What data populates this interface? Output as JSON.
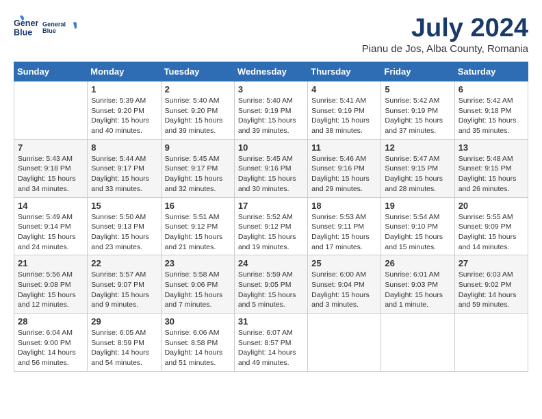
{
  "header": {
    "logo_line1": "General",
    "logo_line2": "Blue",
    "title": "July 2024",
    "subtitle": "Pianu de Jos, Alba County, Romania"
  },
  "calendar": {
    "days_of_week": [
      "Sunday",
      "Monday",
      "Tuesday",
      "Wednesday",
      "Thursday",
      "Friday",
      "Saturday"
    ],
    "weeks": [
      [
        {
          "day": "",
          "info": ""
        },
        {
          "day": "1",
          "info": "Sunrise: 5:39 AM\nSunset: 9:20 PM\nDaylight: 15 hours\nand 40 minutes."
        },
        {
          "day": "2",
          "info": "Sunrise: 5:40 AM\nSunset: 9:20 PM\nDaylight: 15 hours\nand 39 minutes."
        },
        {
          "day": "3",
          "info": "Sunrise: 5:40 AM\nSunset: 9:19 PM\nDaylight: 15 hours\nand 39 minutes."
        },
        {
          "day": "4",
          "info": "Sunrise: 5:41 AM\nSunset: 9:19 PM\nDaylight: 15 hours\nand 38 minutes."
        },
        {
          "day": "5",
          "info": "Sunrise: 5:42 AM\nSunset: 9:19 PM\nDaylight: 15 hours\nand 37 minutes."
        },
        {
          "day": "6",
          "info": "Sunrise: 5:42 AM\nSunset: 9:18 PM\nDaylight: 15 hours\nand 35 minutes."
        }
      ],
      [
        {
          "day": "7",
          "info": "Sunrise: 5:43 AM\nSunset: 9:18 PM\nDaylight: 15 hours\nand 34 minutes."
        },
        {
          "day": "8",
          "info": "Sunrise: 5:44 AM\nSunset: 9:17 PM\nDaylight: 15 hours\nand 33 minutes."
        },
        {
          "day": "9",
          "info": "Sunrise: 5:45 AM\nSunset: 9:17 PM\nDaylight: 15 hours\nand 32 minutes."
        },
        {
          "day": "10",
          "info": "Sunrise: 5:45 AM\nSunset: 9:16 PM\nDaylight: 15 hours\nand 30 minutes."
        },
        {
          "day": "11",
          "info": "Sunrise: 5:46 AM\nSunset: 9:16 PM\nDaylight: 15 hours\nand 29 minutes."
        },
        {
          "day": "12",
          "info": "Sunrise: 5:47 AM\nSunset: 9:15 PM\nDaylight: 15 hours\nand 28 minutes."
        },
        {
          "day": "13",
          "info": "Sunrise: 5:48 AM\nSunset: 9:15 PM\nDaylight: 15 hours\nand 26 minutes."
        }
      ],
      [
        {
          "day": "14",
          "info": "Sunrise: 5:49 AM\nSunset: 9:14 PM\nDaylight: 15 hours\nand 24 minutes."
        },
        {
          "day": "15",
          "info": "Sunrise: 5:50 AM\nSunset: 9:13 PM\nDaylight: 15 hours\nand 23 minutes."
        },
        {
          "day": "16",
          "info": "Sunrise: 5:51 AM\nSunset: 9:12 PM\nDaylight: 15 hours\nand 21 minutes."
        },
        {
          "day": "17",
          "info": "Sunrise: 5:52 AM\nSunset: 9:12 PM\nDaylight: 15 hours\nand 19 minutes."
        },
        {
          "day": "18",
          "info": "Sunrise: 5:53 AM\nSunset: 9:11 PM\nDaylight: 15 hours\nand 17 minutes."
        },
        {
          "day": "19",
          "info": "Sunrise: 5:54 AM\nSunset: 9:10 PM\nDaylight: 15 hours\nand 15 minutes."
        },
        {
          "day": "20",
          "info": "Sunrise: 5:55 AM\nSunset: 9:09 PM\nDaylight: 15 hours\nand 14 minutes."
        }
      ],
      [
        {
          "day": "21",
          "info": "Sunrise: 5:56 AM\nSunset: 9:08 PM\nDaylight: 15 hours\nand 12 minutes."
        },
        {
          "day": "22",
          "info": "Sunrise: 5:57 AM\nSunset: 9:07 PM\nDaylight: 15 hours\nand 9 minutes."
        },
        {
          "day": "23",
          "info": "Sunrise: 5:58 AM\nSunset: 9:06 PM\nDaylight: 15 hours\nand 7 minutes."
        },
        {
          "day": "24",
          "info": "Sunrise: 5:59 AM\nSunset: 9:05 PM\nDaylight: 15 hours\nand 5 minutes."
        },
        {
          "day": "25",
          "info": "Sunrise: 6:00 AM\nSunset: 9:04 PM\nDaylight: 15 hours\nand 3 minutes."
        },
        {
          "day": "26",
          "info": "Sunrise: 6:01 AM\nSunset: 9:03 PM\nDaylight: 15 hours\nand 1 minute."
        },
        {
          "day": "27",
          "info": "Sunrise: 6:03 AM\nSunset: 9:02 PM\nDaylight: 14 hours\nand 59 minutes."
        }
      ],
      [
        {
          "day": "28",
          "info": "Sunrise: 6:04 AM\nSunset: 9:00 PM\nDaylight: 14 hours\nand 56 minutes."
        },
        {
          "day": "29",
          "info": "Sunrise: 6:05 AM\nSunset: 8:59 PM\nDaylight: 14 hours\nand 54 minutes."
        },
        {
          "day": "30",
          "info": "Sunrise: 6:06 AM\nSunset: 8:58 PM\nDaylight: 14 hours\nand 51 minutes."
        },
        {
          "day": "31",
          "info": "Sunrise: 6:07 AM\nSunset: 8:57 PM\nDaylight: 14 hours\nand 49 minutes."
        },
        {
          "day": "",
          "info": ""
        },
        {
          "day": "",
          "info": ""
        },
        {
          "day": "",
          "info": ""
        }
      ]
    ]
  }
}
